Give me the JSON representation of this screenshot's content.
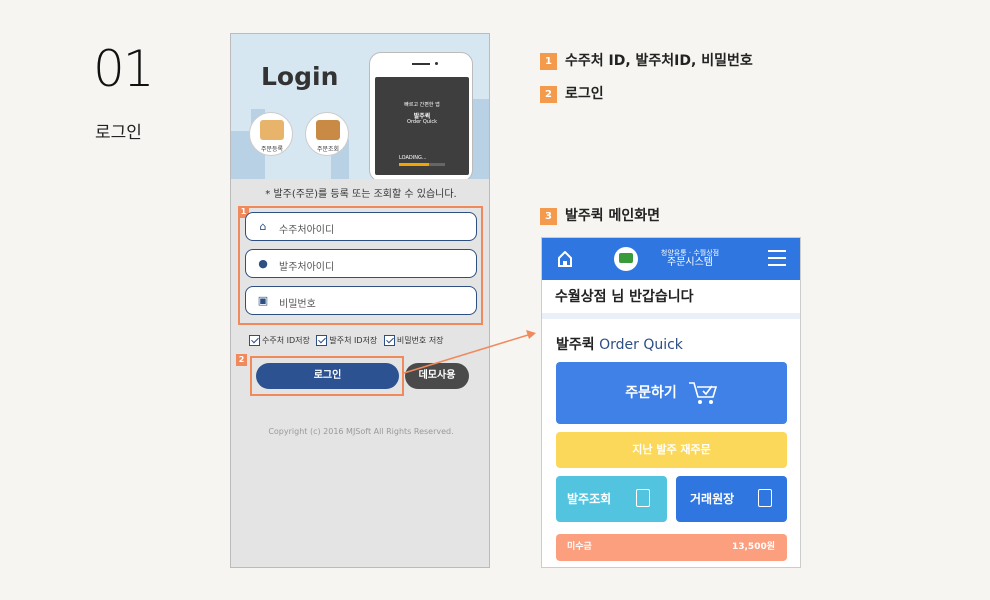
{
  "section": {
    "number": "01",
    "title": "로그인"
  },
  "legend": [
    {
      "num": "1",
      "text": "수주처 ID, 발주처ID, 비밀번호"
    },
    {
      "num": "2",
      "text": "로그인"
    },
    {
      "num": "3",
      "text": "발주퀵 메인화면"
    }
  ],
  "login_screen": {
    "title": "Login",
    "shortcuts": [
      {
        "label": "주문등록",
        "icon": "box-icon"
      },
      {
        "label": "주문조회",
        "icon": "truck-icon"
      }
    ],
    "splash": {
      "line1": "빠르고 간편한 앱",
      "brand": "발주퀵",
      "brand_en": "Order Quick",
      "loading": "LOADING..."
    },
    "notice": "* 발주(주문)를 등록 또는 조회할 수 있습니다.",
    "fields": [
      {
        "placeholder": "수주처아이디",
        "icon": "home-icon"
      },
      {
        "placeholder": "발주처아이디",
        "icon": "user-icon"
      },
      {
        "placeholder": "비밀번호",
        "icon": "lock-icon"
      }
    ],
    "checkboxes": [
      {
        "label": "수주처 ID저장",
        "checked": true
      },
      {
        "label": "발주처 ID저장",
        "checked": true
      },
      {
        "label": "비밀번호 저장",
        "checked": true
      }
    ],
    "login_button": "로그인",
    "demo_button": "데모사용",
    "copyright": "Copyright (c) 2016 MJSoft All Rights Reserved.",
    "callout_1": "1",
    "callout_2": "2"
  },
  "main_screen": {
    "shop_line1": "청양유통 · 수월상점",
    "shop_line2": "주문시스템",
    "greeting": "수월상점 님 반갑습니다",
    "brand_ko": "발주퀵",
    "brand_en": "Order Quick",
    "order_button": "주문하기",
    "reorder_button": "지난 발주 재주문",
    "search_button": "발주조회",
    "ledger_button": "거래원장",
    "unpaid_label": "미수금",
    "unpaid_value": "13,500원"
  },
  "colors": {
    "accent": "#f08a5d",
    "primary": "#2f76e0",
    "navy": "#2d5291",
    "yellow": "#fbd85a",
    "cyan": "#52c4e0",
    "salmon": "#fb9f7f"
  }
}
